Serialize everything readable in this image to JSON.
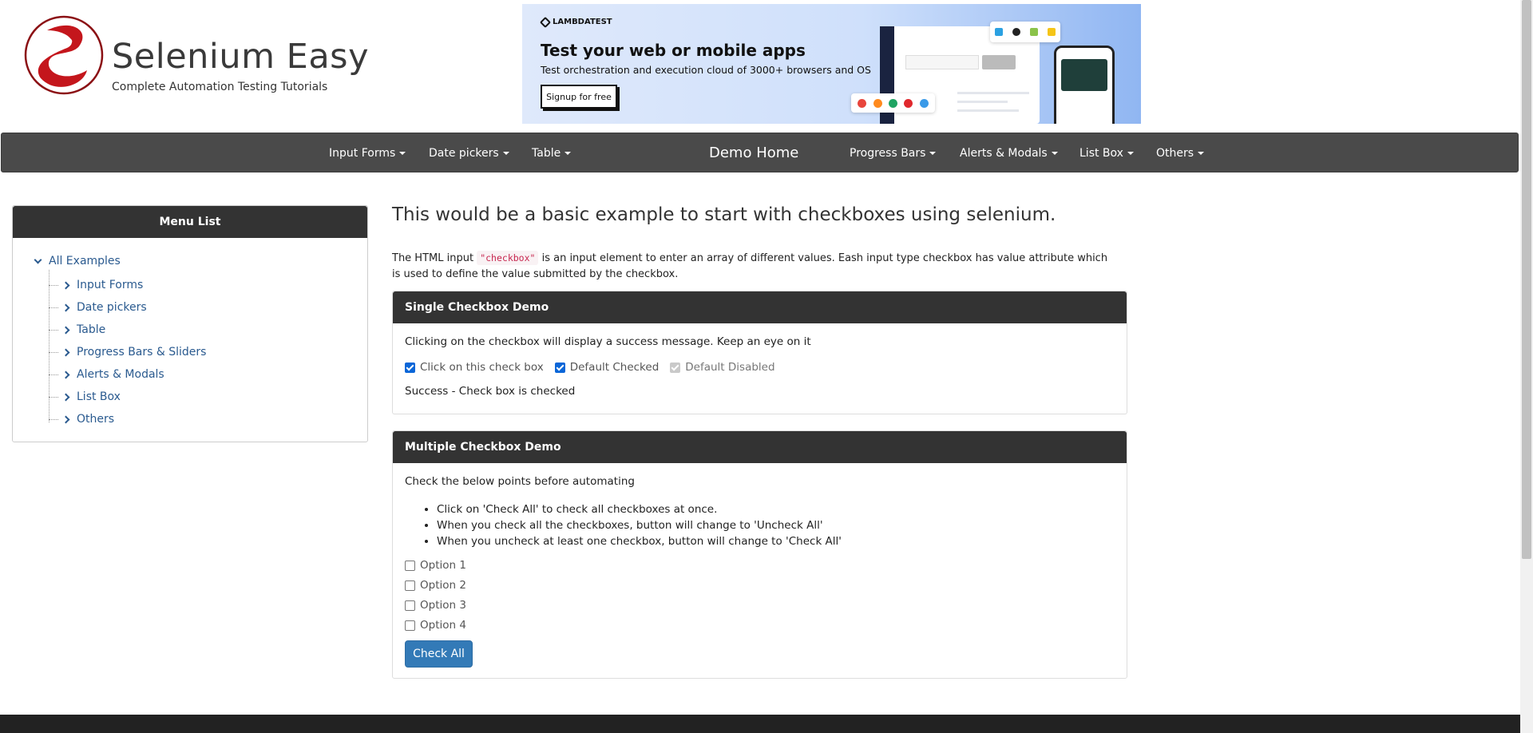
{
  "logo": {
    "title": "Selenium Easy",
    "subtitle": "Complete Automation Testing Tutorials",
    "colors": {
      "accent": "#c4161c"
    }
  },
  "banner": {
    "brand": "LAMBDATEST",
    "title": "Test your web or mobile apps",
    "subtitle": "Test orchestration and execution cloud of 3000+ browsers and OS",
    "button": "Signup for free"
  },
  "nav": {
    "left": [
      "Input Forms",
      "Date pickers",
      "Table"
    ],
    "brand": "Demo Home",
    "right": [
      "Progress Bars",
      "Alerts & Modals",
      "List Box",
      "Others"
    ]
  },
  "sidebar": {
    "heading": "Menu List",
    "root": "All Examples",
    "items": [
      "Input Forms",
      "Date pickers",
      "Table",
      "Progress Bars & Sliders",
      "Alerts & Modals",
      "List Box",
      "Others"
    ]
  },
  "main": {
    "title": "This would be a basic example to start with checkboxes using selenium.",
    "intro_before": "The HTML input ",
    "intro_code": "\"checkbox\"",
    "intro_after": " is an input element to enter an array of different values. Eash input type checkbox has value attribute which is used to define the value submitted by the checkbox."
  },
  "single": {
    "heading": "Single Checkbox Demo",
    "text": "Clicking on the checkbox will display a success message. Keep an eye on it",
    "checkboxes": [
      {
        "label": "Click on this check box",
        "checked": true,
        "disabled": false
      },
      {
        "label": "Default Checked",
        "checked": true,
        "disabled": false
      },
      {
        "label": "Default Disabled",
        "checked": true,
        "disabled": true
      }
    ],
    "message": "Success - Check box is checked"
  },
  "multiple": {
    "heading": "Multiple Checkbox Demo",
    "text": "Check the below points before automating",
    "points": [
      "Click on 'Check All' to check all checkboxes at once.",
      "When you check all the checkboxes, button will change to 'Uncheck All'",
      "When you uncheck at least one checkbox, button will change to 'Check All'"
    ],
    "options": [
      "Option 1",
      "Option 2",
      "Option 3",
      "Option 4"
    ],
    "button": "Check All"
  },
  "colors": {
    "navbar": "#4a4a4a",
    "panel_head": "#333333",
    "link": "#2a5a8f",
    "primary_button": "#337ab7"
  }
}
